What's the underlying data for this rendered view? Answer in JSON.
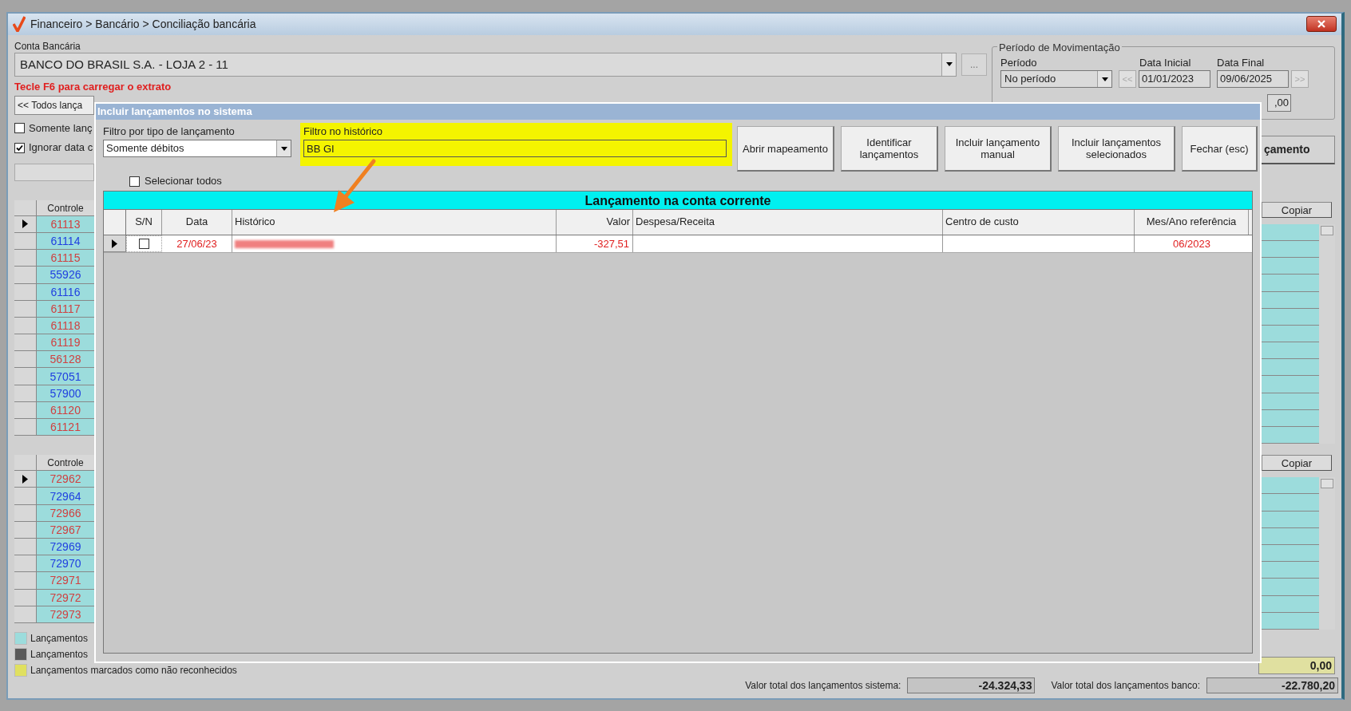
{
  "window": {
    "title": "Financeiro > Bancário > Conciliação bancária"
  },
  "account": {
    "label": "Conta Bancária",
    "value": "BANCO DO BRASIL S.A. - LOJA 2 - 11",
    "more_button": "..."
  },
  "hint": "Tecle F6 para carregar o extrato",
  "all_button": "<< Todos lança",
  "options": [
    {
      "label": "Somente lanç",
      "checked": false
    },
    {
      "label": "Ignorar data c",
      "checked": true
    }
  ],
  "period": {
    "group_title": "Período de Movimentação",
    "period_label": "Período",
    "period_value": "No período",
    "start_label": "Data Inicial",
    "start_value": "01/01/2023",
    "end_label": "Data Final",
    "end_value": "09/06/2025",
    "prev_button": "<<",
    "next_button": ">>",
    "value_field": ",00"
  },
  "action_button": "çamento",
  "system_grid": {
    "column": "Controle",
    "copy_button": "Copiar",
    "rows": [
      {
        "value": "61113",
        "selected": true,
        "color": "#d04040"
      },
      {
        "value": "61114",
        "selected": false,
        "color": "#2040e0"
      },
      {
        "value": "61115",
        "selected": false,
        "color": "#d04040"
      },
      {
        "value": "55926",
        "selected": false,
        "color": "#2040e0"
      },
      {
        "value": "61116",
        "selected": false,
        "color": "#2040e0"
      },
      {
        "value": "61117",
        "selected": false,
        "color": "#d04040"
      },
      {
        "value": "61118",
        "selected": false,
        "color": "#d04040"
      },
      {
        "value": "61119",
        "selected": false,
        "color": "#d04040"
      },
      {
        "value": "56128",
        "selected": false,
        "color": "#d04040"
      },
      {
        "value": "57051",
        "selected": false,
        "color": "#2040e0"
      },
      {
        "value": "57900",
        "selected": false,
        "color": "#2040e0"
      },
      {
        "value": "61120",
        "selected": false,
        "color": "#d04040"
      },
      {
        "value": "61121",
        "selected": false,
        "color": "#d04040"
      }
    ]
  },
  "bank_grid": {
    "column": "Controle",
    "copy_button": "Copiar",
    "rows": [
      {
        "value": "72962",
        "selected": true,
        "color": "#d04040"
      },
      {
        "value": "72964",
        "selected": false,
        "color": "#2040e0"
      },
      {
        "value": "72966",
        "selected": false,
        "color": "#d04040"
      },
      {
        "value": "72967",
        "selected": false,
        "color": "#d04040"
      },
      {
        "value": "72969",
        "selected": false,
        "color": "#2040e0"
      },
      {
        "value": "72970",
        "selected": false,
        "color": "#2040e0"
      },
      {
        "value": "72971",
        "selected": false,
        "color": "#d04040"
      },
      {
        "value": "72972",
        "selected": false,
        "color": "#d04040"
      },
      {
        "value": "72973",
        "selected": false,
        "color": "#d04040"
      }
    ]
  },
  "legend": [
    {
      "label": "Lançamentos",
      "color": "#9cdcdc"
    },
    {
      "label": "Lançamentos",
      "color": "#5a5a5a"
    },
    {
      "label": "Lançamentos marcados como não reconhecidos",
      "color": "#e0e060"
    }
  ],
  "totals": {
    "difference": "0,00",
    "system_label": "Valor total dos lançamentos sistema:",
    "system_value": "-24.324,33",
    "bank_label": "Valor total dos lançamentos banco:",
    "bank_value": "-22.780,20"
  },
  "dialog": {
    "title": "Incluir lançamentos no sistema",
    "type_filter": {
      "label": "Filtro por tipo de lançamento",
      "value": "Somente débitos"
    },
    "history_filter": {
      "label": "Filtro no histórico",
      "value": "BB GI"
    },
    "buttons": [
      "Abrir mapeamento",
      "Identificar lançamentos",
      "Incluir lançamento manual",
      "Incluir lançamentos selecionados",
      "Fechar (esc)"
    ],
    "select_all": {
      "label": "Selecionar todos",
      "checked": false
    },
    "grid": {
      "title": "Lançamento na conta corrente",
      "columns": [
        "S/N",
        "Data",
        "Histórico",
        "Valor",
        "Despesa/Receita",
        "Centro de custo",
        "Mes/Ano referência"
      ],
      "rows": [
        {
          "selected": true,
          "checked": false,
          "date": "27/06/23",
          "history_redacted": true,
          "value": "-327,51",
          "reference": "06/2023"
        }
      ]
    }
  }
}
